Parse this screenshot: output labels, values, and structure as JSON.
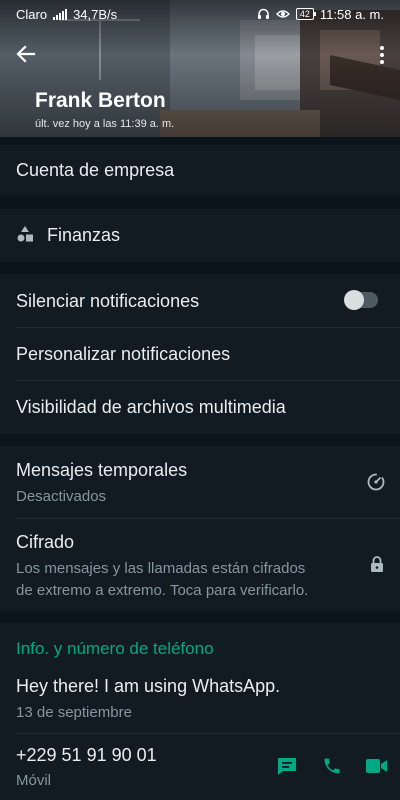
{
  "status_bar": {
    "carrier": "Claro",
    "speed": "34,7B/s",
    "battery": "42",
    "time": "11:58 a. m."
  },
  "contact": {
    "name": "Frank Berton",
    "last_seen": "últ. vez hoy a las 11:39 a. m."
  },
  "business": {
    "account_label": "Cuenta de empresa",
    "category": "Finanzas"
  },
  "notifications": {
    "mute_label": "Silenciar notificaciones",
    "mute_enabled": false,
    "custom_label": "Personalizar notificaciones",
    "media_visibility_label": "Visibilidad de archivos multimedia"
  },
  "privacy": {
    "temporary_label": "Mensajes temporales",
    "temporary_status": "Desactivados",
    "encryption_label": "Cifrado",
    "encryption_desc_line1": "Los mensajes y las llamadas están cifrados",
    "encryption_desc_line2": "de extremo a extremo. Toca para verificarlo."
  },
  "about": {
    "section_title": "Info. y número de teléfono",
    "status_text": "Hey there! I am using WhatsApp.",
    "status_date": "13 de septiembre",
    "phone": "+229 51 91 90 01",
    "phone_type": "Móvil"
  },
  "colors": {
    "background": "#0b141a",
    "section": "#111b21",
    "accent": "#00a884",
    "secondary_text": "#8696a0"
  }
}
